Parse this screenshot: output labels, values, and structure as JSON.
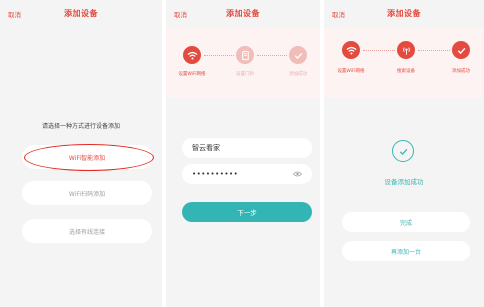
{
  "colors": {
    "accent_red": "#e34b3f",
    "teal": "#33b5b5",
    "step_faded": "#f0bdb9"
  },
  "screen1": {
    "cancel": "取消",
    "title": "添加设备",
    "prompt": "请选择一种方式进行设备添加",
    "options": [
      "WiFi智能添加",
      "WiFi扫码添加",
      "选择有线连接"
    ]
  },
  "screen2": {
    "cancel": "取消",
    "title": "添加设备",
    "steps": [
      "设置WiFi网络",
      "设置门铃",
      "添加成功"
    ],
    "step_icons": [
      "wifi-icon",
      "device-icon",
      "check-icon"
    ],
    "wifi_name": "智云看家",
    "password": "••••••••••",
    "next": "下一步"
  },
  "screen3": {
    "cancel": "取消",
    "title": "添加设备",
    "steps": [
      "设置WiFi网络",
      "搜索设备",
      "添加成功"
    ],
    "step_icons": [
      "wifi-icon",
      "broadcast-icon",
      "check-icon"
    ],
    "success": "设备添加成功",
    "done": "完成",
    "add_another": "再添加一台"
  }
}
